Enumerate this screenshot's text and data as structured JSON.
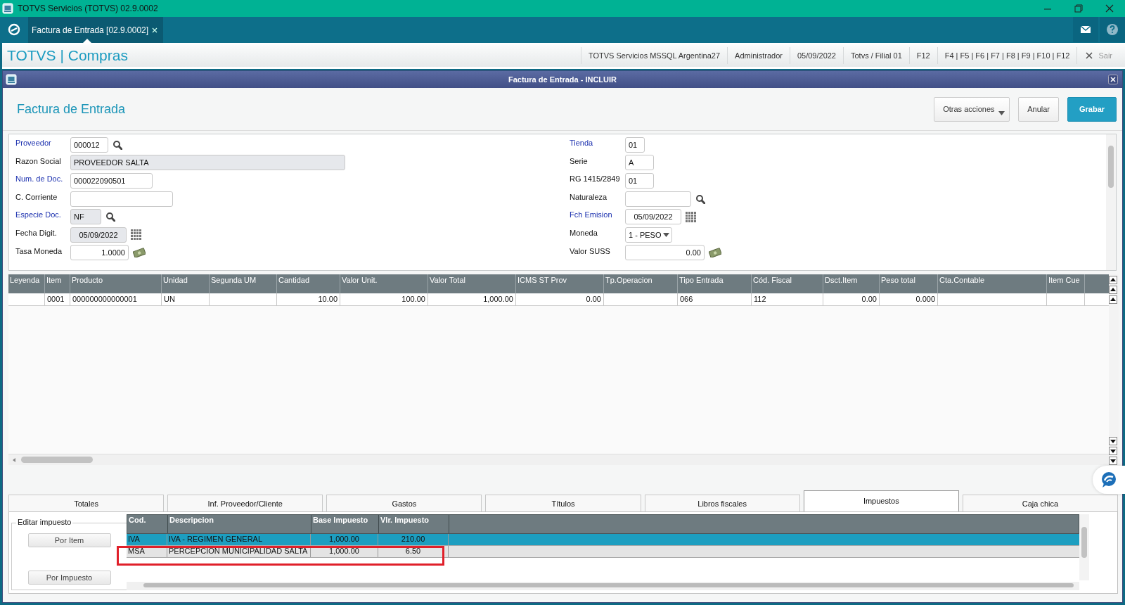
{
  "window": {
    "title": "TOTVS Servicios (TOTVS) 02.9.0002"
  },
  "app_tabs": [
    {
      "label": "Factura de Entrada [02.9.0002]",
      "selected": true
    }
  ],
  "app_header": {
    "brand": "TOTVS | Compras",
    "info": [
      "TOTVS Servicios MSSQL Argentina27",
      "Administrador",
      "05/09/2022",
      "Totvs / Filial 01",
      "F12",
      "F4 | F5 | F6 | F7 | F8 | F9 | F10 | F12"
    ],
    "exit": "Sair"
  },
  "dialog": {
    "title": "Factura de Entrada - INCLUIR",
    "heading": "Factura de Entrada",
    "buttons": [
      {
        "label": "Otras acciones",
        "kind": "menu"
      },
      {
        "label": "Anular",
        "kind": "plain"
      },
      {
        "label": "Grabar",
        "kind": "primary"
      }
    ]
  },
  "form": {
    "left": [
      {
        "label": "Proveedor",
        "required": true,
        "value": "000012",
        "kind": "lookup",
        "disabled": false
      },
      {
        "label": "Razon Social",
        "required": false,
        "value": "PROVEEDOR SALTA",
        "kind": "text",
        "disabled": true
      },
      {
        "label": "Num. de Doc.",
        "required": true,
        "value": "000022090501",
        "kind": "text",
        "disabled": false
      },
      {
        "label": "C. Corriente",
        "required": false,
        "kind": "text",
        "disabled": false
      },
      {
        "label": "Especie Doc.",
        "required": true,
        "value": "NF",
        "kind": "lookup",
        "disabled": true
      },
      {
        "label": "Fecha Digit.",
        "required": false,
        "value": "05/09/2022",
        "kind": "date",
        "disabled": true
      },
      {
        "label": "Tasa Moneda",
        "required": false,
        "value": "1.0000",
        "kind": "currency",
        "disabled": false
      }
    ],
    "right": [
      {
        "label": "Tienda",
        "required": true,
        "value": "01",
        "kind": "text",
        "disabled": false
      },
      {
        "label": "Serie",
        "required": false,
        "value": "A",
        "kind": "text",
        "disabled": false
      },
      {
        "label": "RG 1415/2849",
        "required": false,
        "value": "01",
        "kind": "text",
        "disabled": false
      },
      {
        "label": "Naturaleza",
        "required": false,
        "kind": "lookup",
        "disabled": false
      },
      {
        "label": "Fch Emision",
        "required": true,
        "value": "05/09/2022",
        "kind": "date",
        "disabled": false
      },
      {
        "label": "Moneda",
        "required": false,
        "value": "1 - PESO",
        "kind": "select",
        "disabled": false
      },
      {
        "label": "Valor SUSS",
        "required": false,
        "value": "0.00",
        "kind": "currency",
        "disabled": false
      }
    ]
  },
  "items_table": {
    "columns": [
      "Leyenda",
      "Item",
      "Producto",
      "Unidad",
      "Segunda UM",
      "Cantidad",
      "Valor Unit.",
      "Valor Total",
      "ICMS ST Prov",
      "Tp.Operacion",
      "Tipo Entrada",
      "Cód. Fiscal",
      "Dsct.Item",
      "Peso total",
      "Cta.Contable",
      "Item Cue"
    ],
    "rows": [
      {
        "cells": [
          null,
          "0001",
          "000000000000001",
          "UN",
          null,
          "10.00",
          "100.00",
          "1,000.00",
          "0.00",
          null,
          "066",
          "112",
          "0.00",
          "0.000",
          null,
          null
        ]
      }
    ]
  },
  "folders": [
    {
      "label": "Totales",
      "selected": false
    },
    {
      "label": "Inf. Proveedor/Cliente",
      "selected": false
    },
    {
      "label": "Gastos",
      "selected": false
    },
    {
      "label": "Títulos",
      "selected": false
    },
    {
      "label": "Libros fiscales",
      "selected": false
    },
    {
      "label": "Impuestos",
      "selected": true
    },
    {
      "label": "Caja chica",
      "selected": false
    }
  ],
  "edit_tax": {
    "title": "Editar impuesto",
    "buttons": [
      "Por Item",
      "Por Impuesto"
    ]
  },
  "taxes": {
    "columns": [
      "Cod.",
      "Descripcion",
      "Base Impuesto",
      "Vlr. Impuesto"
    ],
    "rows": [
      {
        "cells": [
          "IVA",
          "IVA - REGIMEN GENERAL",
          "1,000.00",
          "210.00"
        ],
        "selected": true,
        "highlighted": false
      },
      {
        "cells": [
          "MSA",
          "PERCEPCION MUNICIPALIDAD SALTA",
          "1,000.00",
          "6.50"
        ],
        "selected": false,
        "highlighted": true
      }
    ]
  }
}
